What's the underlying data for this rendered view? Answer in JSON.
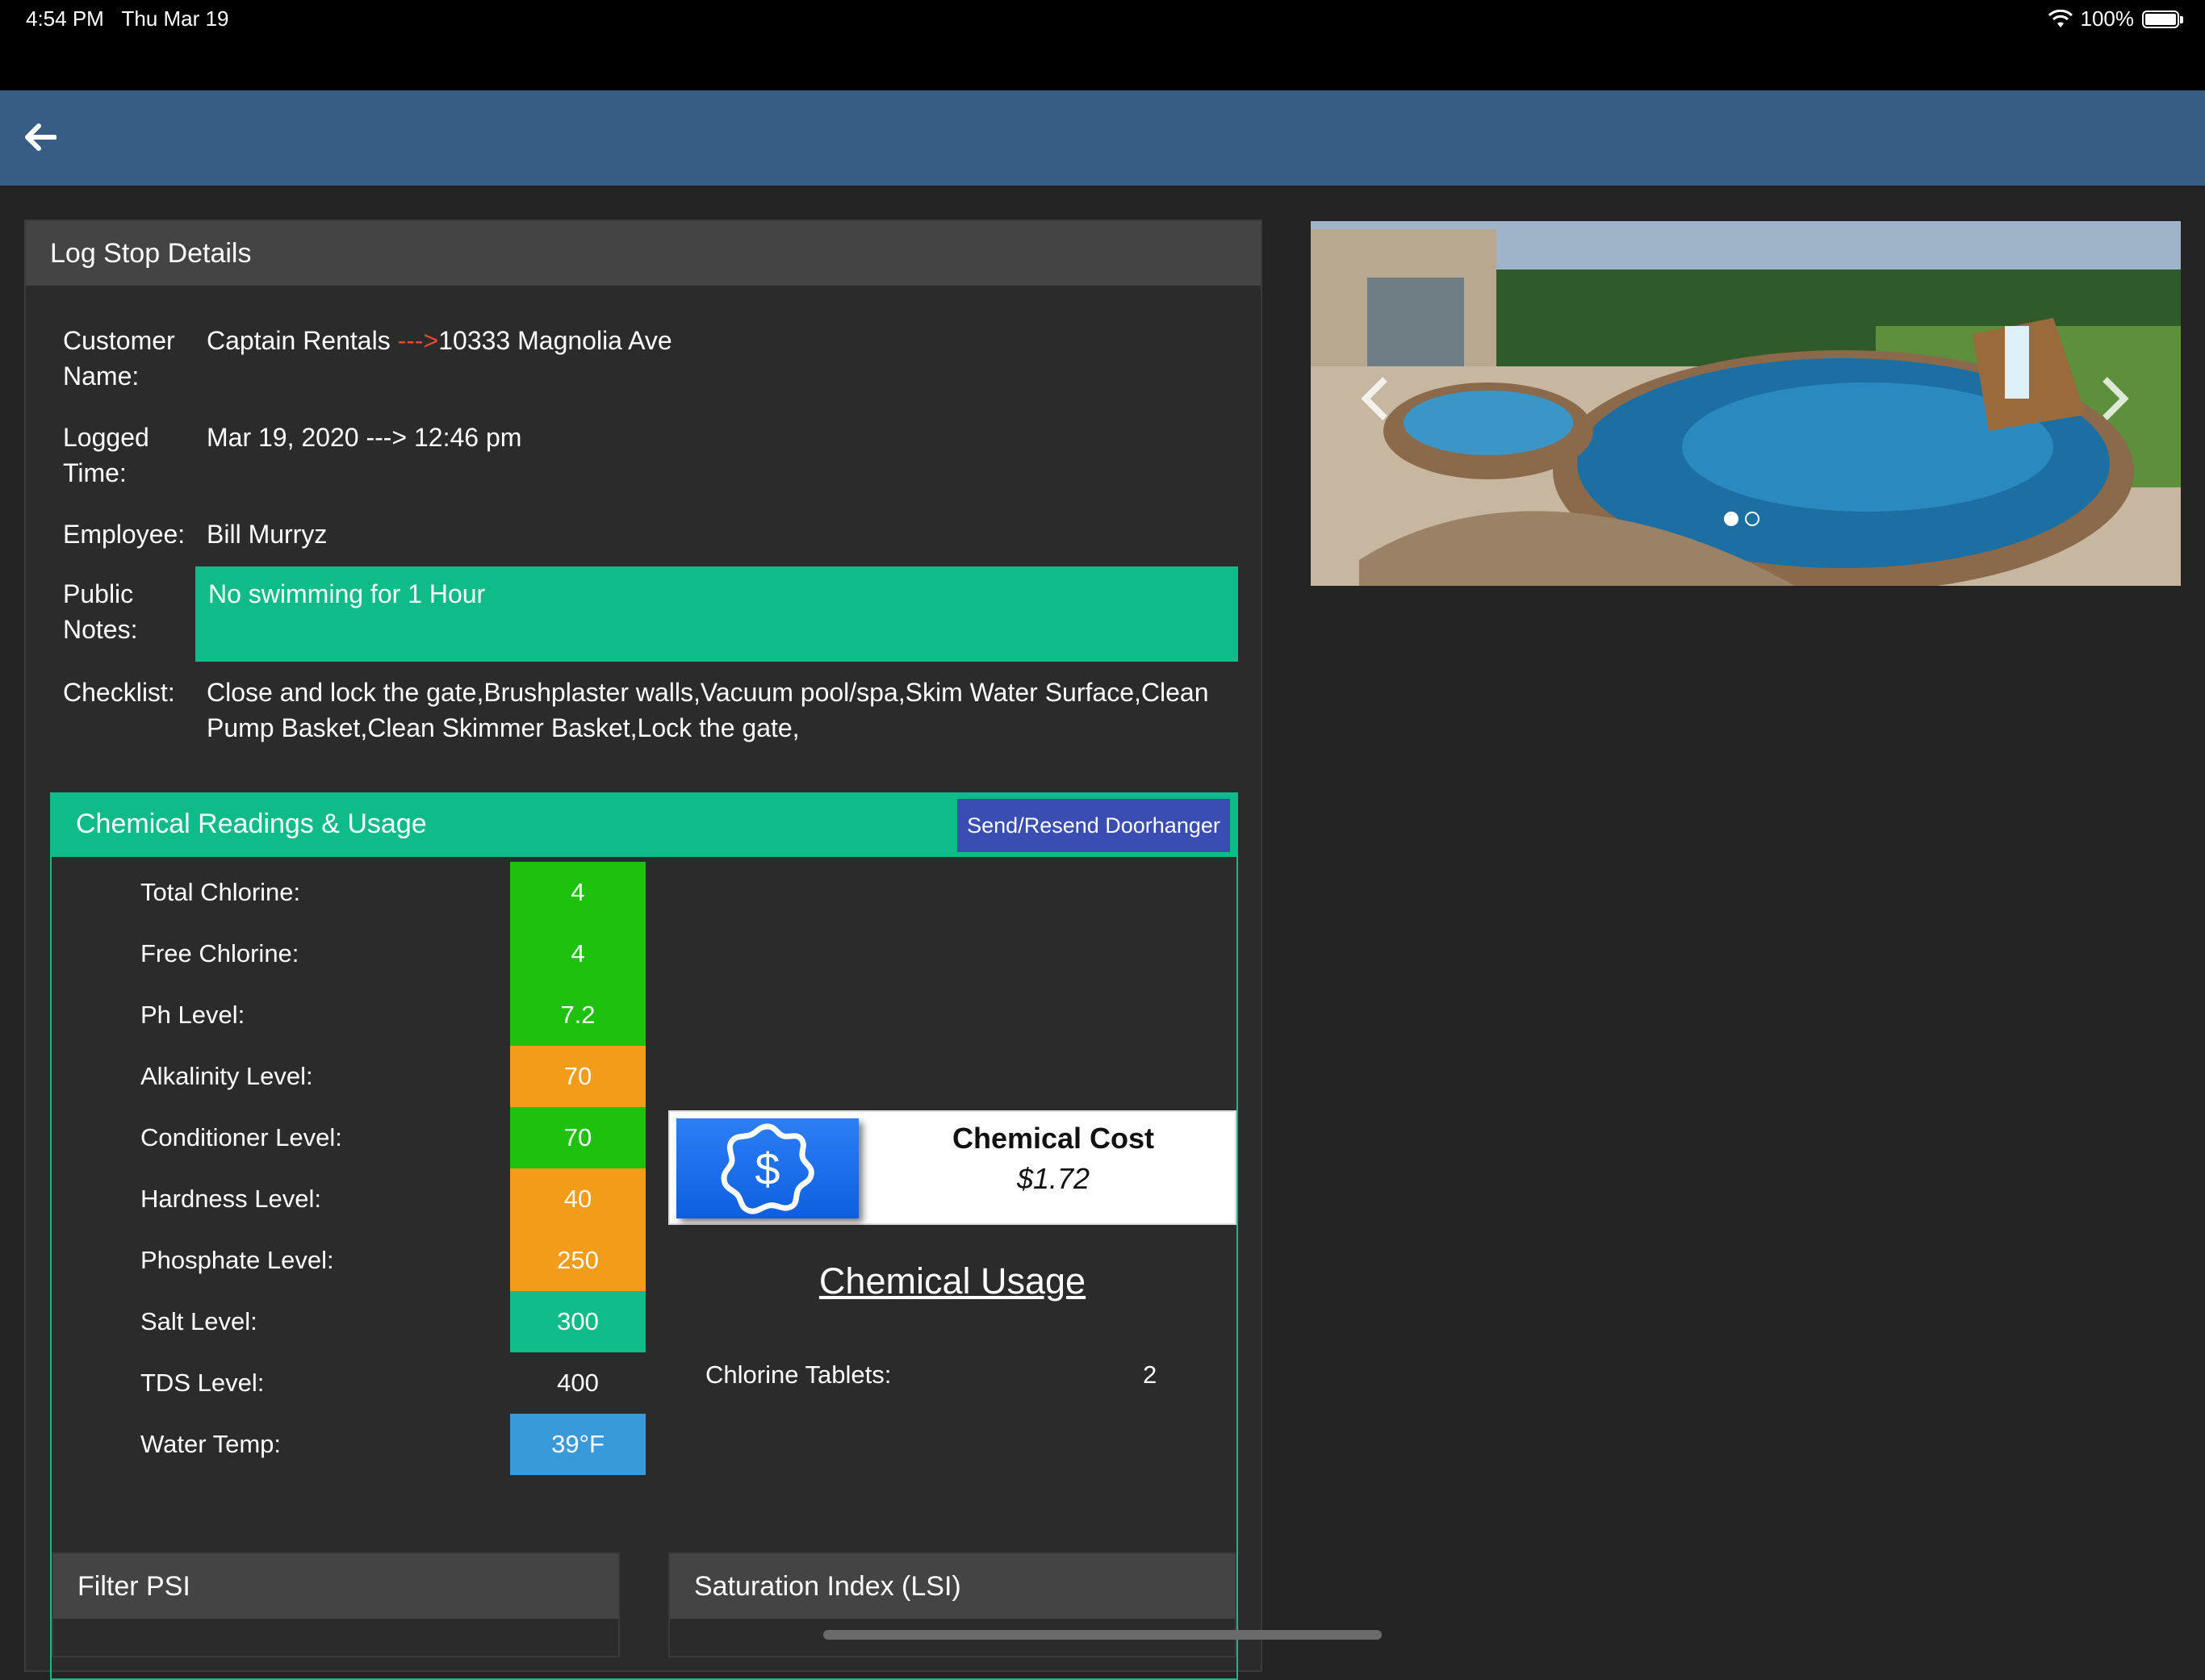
{
  "status_bar": {
    "time": "4:54 PM",
    "date": "Thu Mar 19",
    "battery": "100%"
  },
  "card": {
    "title": "Log Stop Details",
    "details": [
      {
        "label_line1": "Customer",
        "label_line2": "Name:",
        "value_main": "Captain Rentals ",
        "value_arrow": "--->",
        "value_tail": "10333 Magnolia Ave"
      },
      {
        "label_line1": "Logged",
        "label_line2": "Time:",
        "value": "Mar 19, 2020 ---> 12:46 pm"
      },
      {
        "label": "Employee:",
        "value": "Bill Murryz"
      },
      {
        "label_line1": "Public",
        "label_line2": "Notes:",
        "value": "No swimming for 1 Hour"
      },
      {
        "label": "Checklist:",
        "value_line1": "Close and lock the gate,Brushplaster walls,Vacuum pool/spa,Skim Water Surface,Clean",
        "value_line2": "Pump Basket,Clean Skimmer Basket,Lock the gate,"
      }
    ]
  },
  "chemical": {
    "title": "Chemical Readings & Usage",
    "send_button": "Send/Resend Doorhanger",
    "readings": [
      {
        "label": "Total Chlorine:",
        "value": "4",
        "color": "#1fc10f"
      },
      {
        "label": "Free Chlorine:",
        "value": "4",
        "color": "#1fc10f"
      },
      {
        "label": "Ph Level:",
        "value": "7.2",
        "color": "#1fc10f"
      },
      {
        "label": "Alkalinity Level:",
        "value": "70",
        "color": "#f39c1a"
      },
      {
        "label": "Conditioner Level:",
        "value": "70",
        "color": "#1fc10f"
      },
      {
        "label": "Hardness Level:",
        "value": "40",
        "color": "#f39c1a"
      },
      {
        "label": "Phosphate Level:",
        "value": "250",
        "color": "#f39c1a"
      },
      {
        "label": "Salt Level:",
        "value": "300",
        "color": "#0fbc89"
      },
      {
        "label": "TDS Level:",
        "value": "400",
        "color": ""
      },
      {
        "label": "Water Temp:",
        "value": "39°F",
        "color": "#3a9ad9"
      }
    ],
    "cost_label": "Chemical Cost",
    "cost_value": "$1.72",
    "usage_title": "Chemical Usage",
    "usage": [
      {
        "label": "Chlorine Tablets:",
        "value": "2"
      }
    ]
  },
  "sub_cards": {
    "filter": "Filter PSI",
    "lsi": "Saturation Index (LSI)"
  },
  "colors": {
    "app_bar": "#375d85",
    "accent": "#0fbc89",
    "button": "#3a4db0"
  }
}
